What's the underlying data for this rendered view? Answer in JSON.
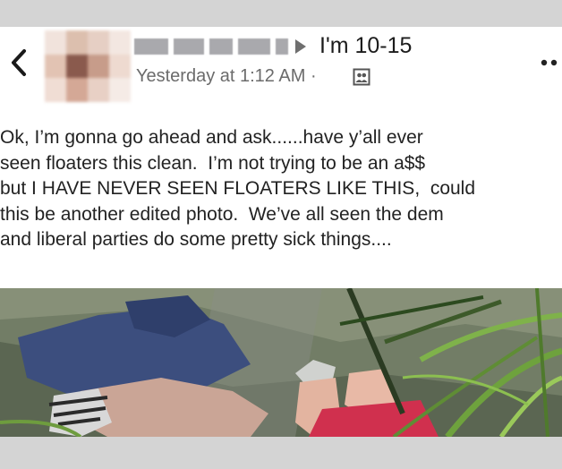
{
  "post": {
    "group_name": "I'm 10-15",
    "timestamp": "Yesterday at 1:12 AM",
    "separator": "·",
    "text": "Ok, I’m gonna go ahead and ask......have y’all ever\nseen floaters this clean.  I’m not trying to be an a$$\nbut I HAVE NEVER SEEN FLOATERS LIKE THIS,  could\nthis be another edited photo.  We’ve all seen the dem\nand liberal parties do some pretty sick things...."
  },
  "icons": {
    "back": "chevron-left-icon",
    "arrow": "triangle-right-icon",
    "privacy": "members-icon",
    "more": "more-dots-icon"
  },
  "colors": {
    "background": "#d9d9d9",
    "card": "#ffffff",
    "text": "#222222",
    "meta": "#6b6b6b",
    "name_redaction": "#a9a9ad"
  }
}
